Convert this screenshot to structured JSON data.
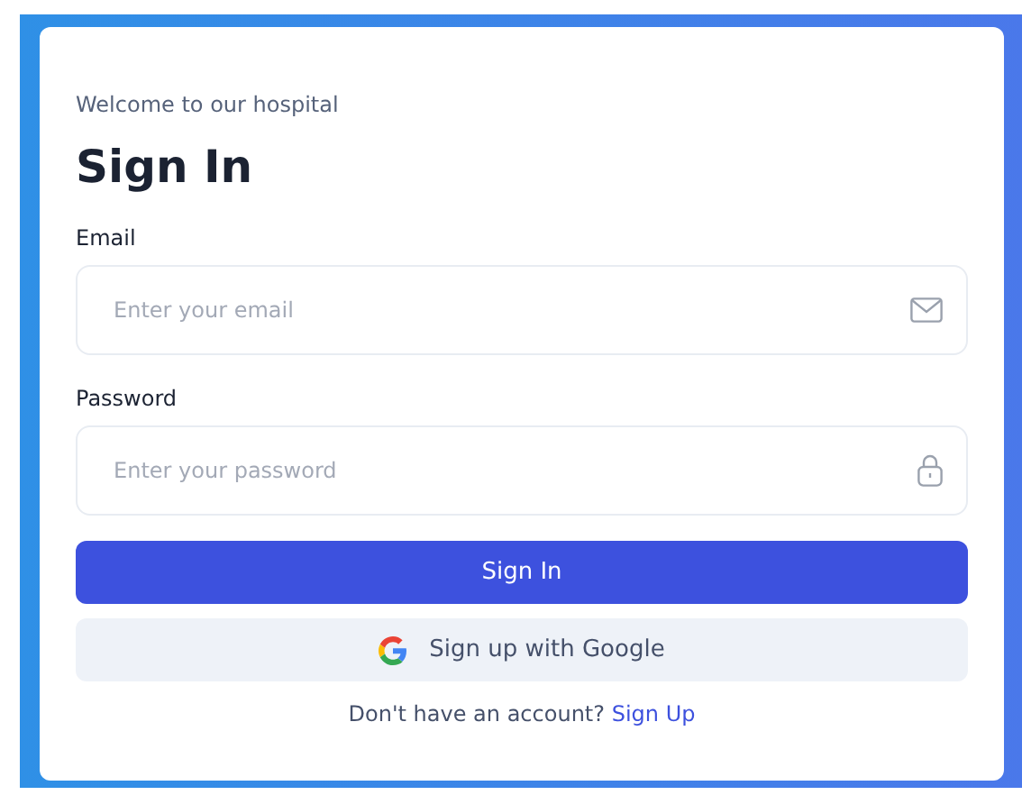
{
  "greeting": "Welcome to our hospital",
  "title": "Sign In",
  "fields": [
    {
      "label": "Email",
      "placeholder": "Enter your email",
      "kind": "email"
    },
    {
      "label": "Password",
      "placeholder": "Enter your password",
      "kind": "password"
    }
  ],
  "primary_button": "Sign In",
  "google_button": "Sign up with Google",
  "footer": {
    "text": "Don't have an account?",
    "link": "Sign Up"
  }
}
